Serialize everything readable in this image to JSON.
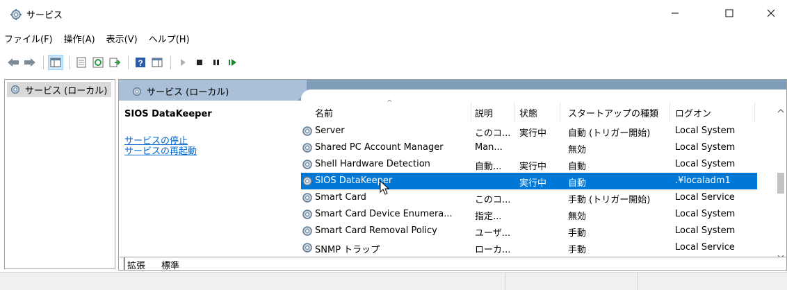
{
  "window": {
    "title": "サービス",
    "icon": "services-gear-icon"
  },
  "menu": [
    "ファイル(F)",
    "操作(A)",
    "表示(V)",
    "ヘルプ(H)"
  ],
  "toolbar": [
    "back-arrow-icon",
    "forward-arrow-icon",
    "show-hide-console-tree-icon",
    "properties-icon",
    "refresh-icon",
    "export-list-icon",
    "help-icon",
    "show-action-pane-icon",
    "start-service-icon",
    "stop-service-icon",
    "pause-service-icon",
    "resume-service-icon"
  ],
  "tree": {
    "item": "サービス (ローカル)"
  },
  "pane": {
    "header": "サービス (ローカル)",
    "selected_service": "SIOS DataKeeper",
    "link_stop": "サービスの停止",
    "link_restart": "サービスの再起動"
  },
  "columns": {
    "name": "名前",
    "description": "説明",
    "status": "状態",
    "startup": "スタートアップの種類",
    "logon": "ログオン"
  },
  "rows": [
    {
      "name": "Server",
      "description": "このコ...",
      "status": "実行中",
      "startup": "自動 (トリガー開始)",
      "logon": "Local System"
    },
    {
      "name": "Shared PC Account Manager",
      "description": "Man...",
      "status": "",
      "startup": "無効",
      "logon": "Local System"
    },
    {
      "name": "Shell Hardware Detection",
      "description": "自動...",
      "status": "実行中",
      "startup": "自動",
      "logon": "Local System"
    },
    {
      "name": "SIOS DataKeeper",
      "description": "",
      "status": "実行中",
      "startup": "自動",
      "logon": ".¥localadm1"
    },
    {
      "name": "Smart Card",
      "description": "このコ...",
      "status": "",
      "startup": "手動 (トリガー開始)",
      "logon": "Local Service"
    },
    {
      "name": "Smart Card Device Enumera...",
      "description": "指定...",
      "status": "",
      "startup": "無効",
      "logon": "Local System"
    },
    {
      "name": "Smart Card Removal Policy",
      "description": "ユーザ...",
      "status": "",
      "startup": "手動",
      "logon": "Local System"
    },
    {
      "name": "SNMP トラップ",
      "description": "ローカ...",
      "status": "",
      "startup": "手動",
      "logon": "Local Service"
    }
  ],
  "selected_row_index": 3,
  "tabs": {
    "extended": "拡張",
    "standard": "標準"
  },
  "colors": {
    "selection": "#0078d7",
    "pane_header": "#7f9db9",
    "link": "#0066cc"
  }
}
